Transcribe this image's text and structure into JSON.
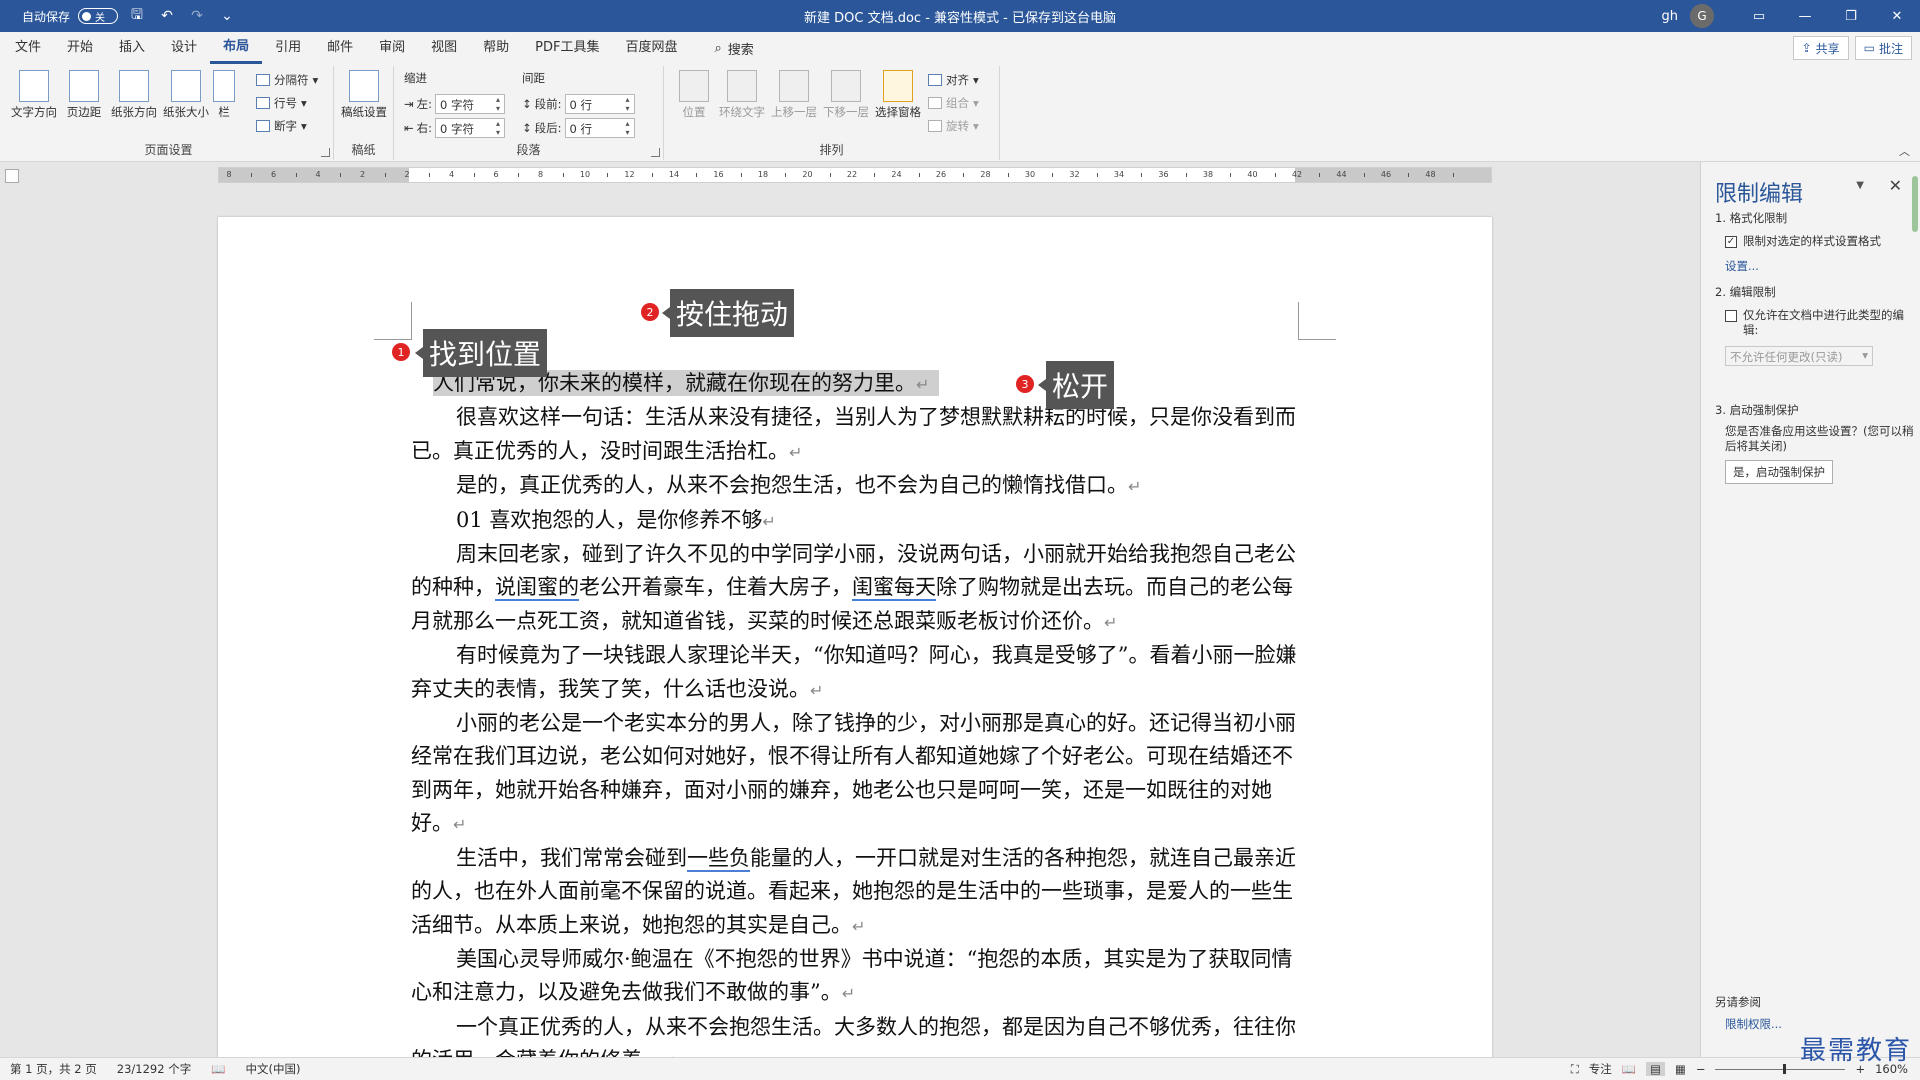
{
  "titlebar": {
    "autosave_label": "自动保存",
    "autosave_state": "关",
    "doc_title": "新建 DOC 文档.doc  -  兼容性模式 - 已保存到这台电脑",
    "user_name": "gh",
    "avatar_letter": "G",
    "minimize": "—",
    "restore": "❐",
    "close": "✕",
    "ribbon_display": "▭"
  },
  "tabs": [
    "文件",
    "开始",
    "插入",
    "设计",
    "布局",
    "引用",
    "邮件",
    "审阅",
    "视图",
    "帮助",
    "PDF工具集",
    "百度网盘"
  ],
  "active_tab": "布局",
  "search_label": "搜索",
  "share_label": "共享",
  "comment_label": "批注",
  "ribbon": {
    "page_setup": {
      "label": "页面设置",
      "text_direction": "文字方向",
      "margins": "页边距",
      "orientation": "纸张方向",
      "size": "纸张大小",
      "columns": "栏",
      "breaks": "分隔符",
      "line_numbers": "行号",
      "hyphenation": "断字"
    },
    "manuscript": {
      "label": "稿纸",
      "button": "稿纸设置"
    },
    "paragraph": {
      "label": "段落",
      "indent_title": "缩进",
      "spacing_title": "间距",
      "left_label": "左:",
      "left_value": "0 字符",
      "right_label": "右:",
      "right_value": "0 字符",
      "before_label": "段前:",
      "before_value": "0 行",
      "after_label": "段后:",
      "after_value": "0 行"
    },
    "arrange": {
      "label": "排列",
      "position": "位置",
      "wrap_text": "环绕文字",
      "bring_forward": "上移一层",
      "send_backward": "下移一层",
      "selection_pane": "选择窗格",
      "align": "对齐",
      "group": "组合",
      "rotate": "旋转"
    }
  },
  "ruler": {
    "labels": [
      "8",
      "6",
      "4",
      "2",
      "2",
      "4",
      "6",
      "8",
      "10",
      "12",
      "14",
      "16",
      "18",
      "20",
      "22",
      "24",
      "26",
      "28",
      "30",
      "32",
      "34",
      "36",
      "38",
      "40",
      "42",
      "44",
      "46",
      "48"
    ]
  },
  "document": {
    "paragraphs": [
      "人们常说，你未来的模样，就藏在你现在的努力里。",
      "很喜欢这样一句话：生活从来没有捷径，当别人为了梦想默默耕耘的时候，只是你没看到而已。真正优秀的人，没时间跟生活抬杠。",
      "是的，真正优秀的人，从来不会抱怨生活，也不会为自己的懒惰找借口。",
      "01  喜欢抱怨的人，是你修养不够",
      "有时候竟为了一块钱跟人家理论半天，“你知道吗？阿心，我真是受够了”。看着小丽一脸嫌弃丈夫的表情，我笑了笑，什么话也没说。",
      "小丽的老公是一个老实本分的男人，除了钱挣的少，对小丽那是真心的好。还记得当初小丽经常在我们耳边说，老公如何对她好，恨不得让所有人都知道她嫁了个好老公。可现在结婚还不到两年，她就开始各种嫌弃，面对小丽的嫌弃，她老公也只是呵呵一笑，还是一如既往的对她好。",
      "美国心灵导师威尔·鲍温在《不抱怨的世界》书中说道：“抱怨的本质，其实是为了获取同情心和注意力，以及避免去做我们不敢做的事”。",
      "一个真正优秀的人，从来不会抱怨生活。大多数人的抱怨，都是因为自己不够优秀，往往你的活用，会藏着你的修养。"
    ],
    "p5_a": "周末回老家，碰到了许久不见的中学同学小丽，没说两句话，小丽就开始给我抱怨自己老公的种种，",
    "p5_u1": "说闺蜜的",
    "p5_b": "老公开着豪车，住着大房子，",
    "p5_u2": "闺蜜每天",
    "p5_c": "除了购物就是出去玩。而自己的老公每月就那么一点死工资，就知道省钱，买菜的时候还总跟菜贩老板讨价还价。",
    "p9_a": "生活中，我们常常会碰到",
    "p9_u": "一些负",
    "p9_b": "能量的人，一开口就是对生活的各种抱怨，就连自己最亲近的人，也在外人面前毫不保留的说道。看起来，她抱怨的是生活中的一些琐事，是爱人的一些生活细节。从本质上来说，她抱怨的其实是自己。",
    "paragraph_mark": "↵"
  },
  "callouts": {
    "c1_num": "1",
    "c1_text": "找到位置",
    "c2_num": "2",
    "c2_text": "按住拖动",
    "c3_num": "3",
    "c3_text": "松开"
  },
  "pane": {
    "title": "限制编辑",
    "s1_title": "1. 格式化限制",
    "s1_check": "限制对选定的样式设置格式",
    "s1_checked": true,
    "s1_link": "设置...",
    "s2_title": "2. 编辑限制",
    "s2_check": "仅允许在文档中进行此类型的编辑:",
    "s2_checked": false,
    "s2_select": "不允许任何更改(只读)",
    "s3_title": "3. 启动强制保护",
    "s3_text": "您是否准备应用这些设置？(您可以稍后将其关闭)",
    "s3_button": "是，启动强制保护",
    "see_also": "另请参阅",
    "perm_link": "限制权限..."
  },
  "statusbar": {
    "page": "第 1 页，共 2 页",
    "words": "23/1292 个字",
    "language": "中文(中国)",
    "focus": "专注",
    "zoom": "160%"
  },
  "watermark": "最需教育"
}
